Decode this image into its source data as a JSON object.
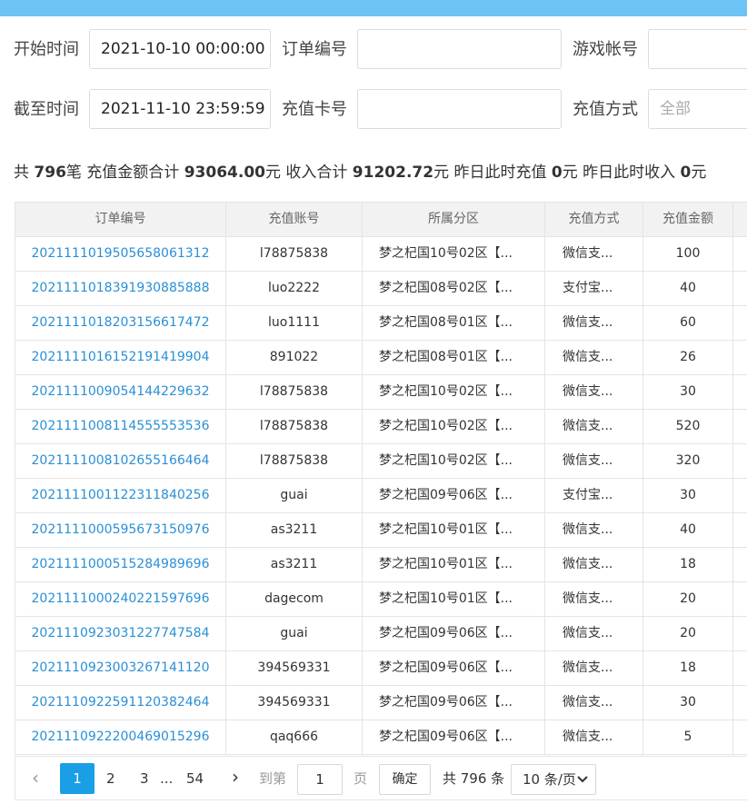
{
  "filters": {
    "start_time_label": "开始时间",
    "start_time_value": "2021-10-10 00:00:00",
    "order_no_label": "订单编号",
    "order_no_value": "",
    "game_account_label": "游戏帐号",
    "game_account_value": "",
    "end_time_label": "截至时间",
    "end_time_value": "2021-11-10 23:59:59",
    "card_no_label": "充值卡号",
    "card_no_value": "",
    "method_label": "充值方式",
    "method_placeholder": "全部"
  },
  "summary": {
    "t1": "共 ",
    "count": "796",
    "t2": "笔 充值金额合计 ",
    "total_amount": "93064.00",
    "t3": "元 收入合计 ",
    "total_income": "91202.72",
    "t4": "元 昨日此时充值 ",
    "yesterday_recharge": "0",
    "t5": "元 昨日此时收入 ",
    "yesterday_income": "0",
    "t6": "元"
  },
  "table": {
    "headers": [
      "订单编号",
      "充值账号",
      "所属分区",
      "充值方式",
      "充值金额"
    ],
    "rows": [
      [
        "2021111019505658061312",
        "l78875838",
        "梦之杞国10号02区【...",
        "微信支...",
        "100"
      ],
      [
        "2021111018391930885888",
        "luo2222",
        "梦之杞国08号02区【...",
        "支付宝...",
        "40"
      ],
      [
        "2021111018203156617472",
        "luo1111",
        "梦之杞国08号01区【...",
        "微信支...",
        "60"
      ],
      [
        "2021111016152191419904",
        "891022",
        "梦之杞国08号01区【...",
        "微信支...",
        "26"
      ],
      [
        "2021111009054144229632",
        "l78875838",
        "梦之杞国10号02区【...",
        "微信支...",
        "30"
      ],
      [
        "2021111008114555553536",
        "l78875838",
        "梦之杞国10号02区【...",
        "微信支...",
        "520"
      ],
      [
        "2021111008102655166464",
        "l78875838",
        "梦之杞国10号02区【...",
        "微信支...",
        "320"
      ],
      [
        "2021111001122311840256",
        "guai",
        "梦之杞国09号06区【...",
        "支付宝...",
        "30"
      ],
      [
        "2021111000595673150976",
        "as3211",
        "梦之杞国10号01区【...",
        "微信支...",
        "40"
      ],
      [
        "2021111000515284989696",
        "as3211",
        "梦之杞国10号01区【...",
        "微信支...",
        "18"
      ],
      [
        "2021111000240221597696",
        "dagecom",
        "梦之杞国10号01区【...",
        "微信支...",
        "20"
      ],
      [
        "2021110923031227747584",
        "guai",
        "梦之杞国09号06区【...",
        "微信支...",
        "20"
      ],
      [
        "2021110923003267141120",
        "394569331",
        "梦之杞国09号06区【...",
        "微信支...",
        "18"
      ],
      [
        "2021110922591120382464",
        "394569331",
        "梦之杞国09号06区【...",
        "微信支...",
        "30"
      ],
      [
        "2021110922200469015296",
        "qaq666",
        "梦之杞国09号06区【...",
        "微信支...",
        "5"
      ]
    ]
  },
  "pagination": {
    "prev_icon": "chevron-left-icon",
    "next_icon": "chevron-right-icon",
    "pages": [
      "1",
      "2",
      "3"
    ],
    "ellipsis": "...",
    "last_page": "54",
    "current_page": "1",
    "goto_label": "到第",
    "goto_value": "1",
    "page_unit": "页",
    "confirm_label": "确定",
    "total_text": "共 796 条",
    "page_size": "10 条/页",
    "accent_color": "#1a9fe6"
  }
}
